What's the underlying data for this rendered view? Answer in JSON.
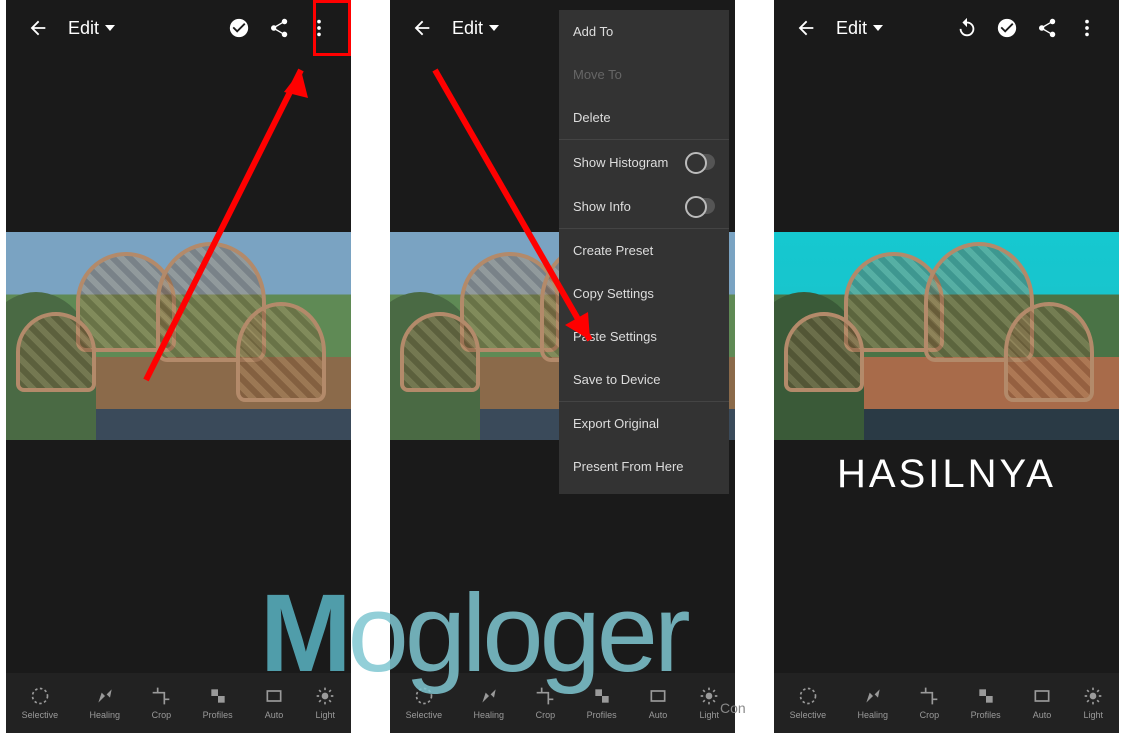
{
  "topbar": {
    "edit_label": "Edit"
  },
  "tools": {
    "t0": "Selective",
    "t1": "Healing",
    "t2": "Crop",
    "t3": "Profiles",
    "t4": "Auto",
    "t5": "Light"
  },
  "menu": {
    "add_to": "Add To",
    "move_to": "Move To",
    "delete": "Delete",
    "show_histogram": "Show Histogram",
    "show_info": "Show Info",
    "create_preset": "Create Preset",
    "copy_settings": "Copy Settings",
    "paste_settings": "Paste Settings",
    "save_to_device": "Save to Device",
    "export_original": "Export Original",
    "present_from_here": "Present From Here"
  },
  "result_label": "HASILNYA",
  "watermark": {
    "big_m": "M",
    "rest": "ogloger",
    "sub": "Con"
  }
}
